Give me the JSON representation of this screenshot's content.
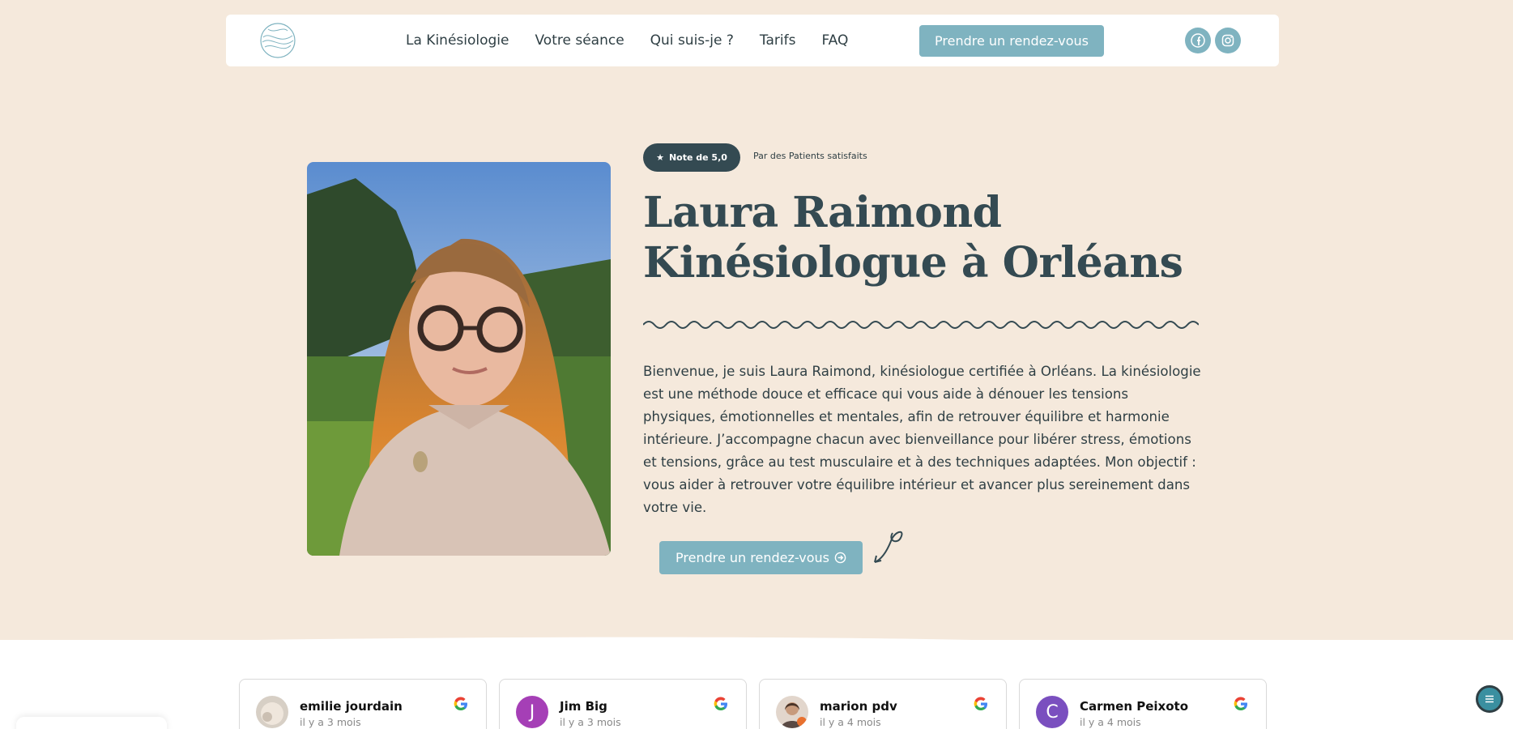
{
  "nav": {
    "items": [
      {
        "label": "La Kinésiologie"
      },
      {
        "label": "Votre séance"
      },
      {
        "label": "Qui suis-je ?"
      },
      {
        "label": "Tarifs"
      },
      {
        "label": "FAQ"
      }
    ],
    "cta": "Prendre un rendez-vous",
    "social": [
      {
        "icon": "facebook-icon"
      },
      {
        "icon": "instagram-icon"
      }
    ]
  },
  "hero": {
    "badge": "Note de 5,0",
    "badge_note": "Par des Patients satisfaits",
    "title_line1": "Laura Raimond",
    "title_line2": "Kinésiologue à Orléans",
    "intro": "Bienvenue, je suis Laura Raimond, kinésiologue certifiée à Orléans. La kinésiologie est une méthode douce et efficace qui vous aide à dénouer les tensions physiques, émotionnelles et mentales, afin de retrouver équilibre et harmonie intérieure. J’accompagne chacun avec bienveillance pour libérer stress, émotions et tensions, grâce au test musculaire et à des techniques adaptées. Mon objectif : vous aider à retrouver votre équilibre intérieur et avancer plus sereinement dans votre vie.",
    "cta": "Prendre un rendez-vous"
  },
  "reviews": [
    {
      "name": "emilie jourdain",
      "date": "il y a 3 mois",
      "initial": ""
    },
    {
      "name": "Jim Big",
      "date": "il y a 3 mois",
      "initial": "J"
    },
    {
      "name": "marion pdv",
      "date": "il y a 4 mois",
      "initial": ""
    },
    {
      "name": "Carmen Peixoto",
      "date": "il y a 4 mois",
      "initial": "C"
    }
  ],
  "colors": {
    "background": "#f5e9dc",
    "accent": "#7fb3c0",
    "dark": "#344a52"
  }
}
